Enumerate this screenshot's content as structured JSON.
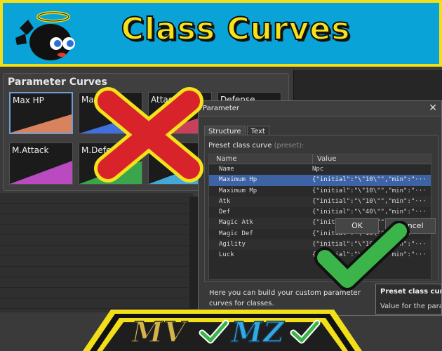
{
  "banner": {
    "title": "Class Curves"
  },
  "curves": {
    "title": "Parameter Curves",
    "boxes": [
      {
        "label": "Max HP",
        "color": "#d9835e"
      },
      {
        "label": "Max MP",
        "color": "#3f6fe0"
      },
      {
        "label": "Attack",
        "color": "#c9405a"
      },
      {
        "label": "Defense",
        "color": "#c9a53a"
      },
      {
        "label": "M.Attack",
        "color": "#b94ac0"
      },
      {
        "label": "M.Defense",
        "color": "#3aa64b"
      },
      {
        "label": "Agility",
        "color": "#45a7d8"
      }
    ]
  },
  "dialog": {
    "title": "Parameter",
    "close": "✕",
    "tabs": [
      "Structure",
      "Text"
    ],
    "preset_label": "Preset class curve",
    "preset_hint": "(preset):",
    "columns": {
      "name": "Name",
      "value": "Value"
    },
    "rows": [
      {
        "name": "Name",
        "value": "Npc"
      },
      {
        "name": "Maximum Hp",
        "value": "{\"initial\":\"\\\"10\\\"\",\"min\":\"···"
      },
      {
        "name": "Maximum Mp",
        "value": "{\"initial\":\"\\\"10\\\"\",\"min\":\"···"
      },
      {
        "name": "Atk",
        "value": "{\"initial\":\"\\\"10\\\"\",\"min\":\"···"
      },
      {
        "name": "Def",
        "value": "{\"initial\":\"\\\"40\\\"\",\"min\":\"···"
      },
      {
        "name": "Magic Atk",
        "value": "{\"initial\":\"\\\"10\\\"\",\"min\":\"···"
      },
      {
        "name": "Magic Def",
        "value": "{\"initial\":\"\\\"10\\\"\",\"min\":\"···"
      },
      {
        "name": "Agility",
        "value": "{\"initial\":\"\\\"10\\\"\",\"min\":\"···"
      },
      {
        "name": "Luck",
        "value": "{\"initial\":\"\\\"10\\\"\",\"min\":\"···"
      }
    ],
    "help": "Here you can build your custom parameter curves for classes.",
    "ok": "OK",
    "cancel": "Cancel"
  },
  "tooltip": {
    "title": "Preset class curve",
    "desc": "Value for the param"
  },
  "badge": {
    "mv": "MV",
    "mz": "MZ"
  },
  "colors": {
    "banner_bg": "#09a3d8",
    "banner_border": "#f2df1a",
    "selection": "#3d63a5",
    "reject": "#d8232a",
    "approve": "#3bb54a"
  },
  "icons": [
    "mascot-icon",
    "close-icon",
    "red-x-icon",
    "green-check-icon"
  ]
}
